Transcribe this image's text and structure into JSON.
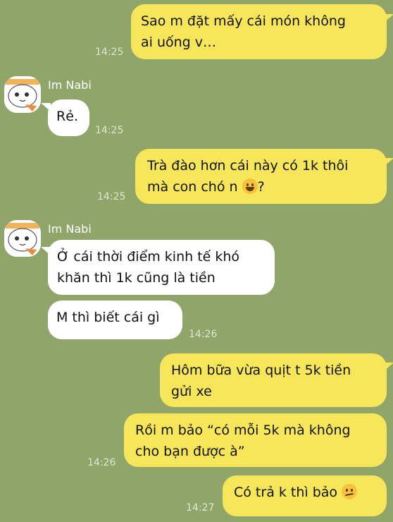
{
  "contact": {
    "name": "Im Nabi"
  },
  "colors": {
    "background": "#8fa56a",
    "outgoing_bubble": "#f6e65a",
    "incoming_bubble": "#ffffff"
  },
  "messages": [
    {
      "from": "me",
      "text": "Sao m đặt mấy cái món không\nai uống v…",
      "time": "14:25"
    },
    {
      "from": "Im Nabi",
      "text": "Rẻ.",
      "time": "14:25"
    },
    {
      "from": "me",
      "text_line1": "Trà đào hơn cái này có 1k thôi",
      "text_line2_pre": "mà con chó n ",
      "emoji": "grinning-emoji",
      "text_line2_post": "?",
      "time": "14:25"
    },
    {
      "from": "Im Nabi",
      "text": "Ở cái thời điểm kinh tế khó\nkhăn thì 1k cũng là tiền"
    },
    {
      "from": "Im Nabi",
      "text": "M thì biết cái gì",
      "time": "14:26"
    },
    {
      "from": "me",
      "text": "Hôm bữa vừa quịt t 5k tiền\ngửi xe"
    },
    {
      "from": "me",
      "text": "Rồi m bảo “có mỗi 5k mà không\ncho bạn được à”",
      "time": "14:26"
    },
    {
      "from": "me",
      "text_pre": "Có trả k thì bảo ",
      "emoji": "smirking-emoji",
      "time": "14:27"
    }
  ]
}
